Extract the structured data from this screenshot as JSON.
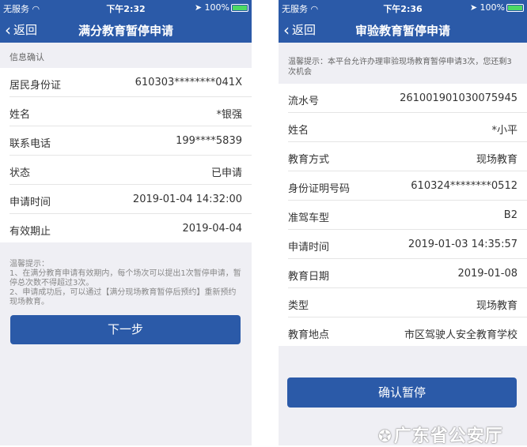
{
  "left": {
    "status": {
      "carrier": "无服务",
      "time": "下午2:32",
      "battery": "100%"
    },
    "nav": {
      "back": "返回",
      "title": "满分教育暂停申请"
    },
    "section_header": "信息确认",
    "rows": [
      {
        "label": "居民身份证",
        "value": "610303********041X"
      },
      {
        "label": "姓名",
        "value": "*银强"
      },
      {
        "label": "联系电话",
        "value": "199****5839"
      },
      {
        "label": "状态",
        "value": "已申请"
      },
      {
        "label": "申请时间",
        "value": "2019-01-04 14:32:00"
      },
      {
        "label": "有效期止",
        "value": "2019-04-04"
      }
    ],
    "tips": [
      "温馨提示：",
      "1、在满分教育申请有效期内，每个场次可以提出1次暂停申请，暂停总次数不得超过3次。",
      "2、申请成功后，可以通过【满分现场教育暂停后预约】重新预约现场教育。"
    ],
    "button": "下一步"
  },
  "right": {
    "status": {
      "carrier": "无服务",
      "time": "下午2:36",
      "battery": "100%"
    },
    "nav": {
      "back": "返回",
      "title": "审验教育暂停申请"
    },
    "tip": "温馨提示：本平台允许办理审验现场教育暂停申请3次，您还剩3次机会",
    "rows": [
      {
        "label": "流水号",
        "value": "261001901030075945"
      },
      {
        "label": "姓名",
        "value": "*小平"
      },
      {
        "label": "教育方式",
        "value": "现场教育"
      },
      {
        "label": "身份证明号码",
        "value": "610324********0512"
      },
      {
        "label": "准驾车型",
        "value": "B2"
      },
      {
        "label": "申请时间",
        "value": "2019-01-03 14:35:57"
      },
      {
        "label": "教育日期",
        "value": "2019-01-08"
      },
      {
        "label": "类型",
        "value": "现场教育"
      },
      {
        "label": "教育地点",
        "value": "市区驾驶人安全教育学校"
      }
    ],
    "button": "确认暂停"
  },
  "watermark": "广东省公安厅",
  "colors": {
    "nav": "#2b5aa8",
    "button": "#2b5aa8",
    "background": "#efeff4"
  }
}
